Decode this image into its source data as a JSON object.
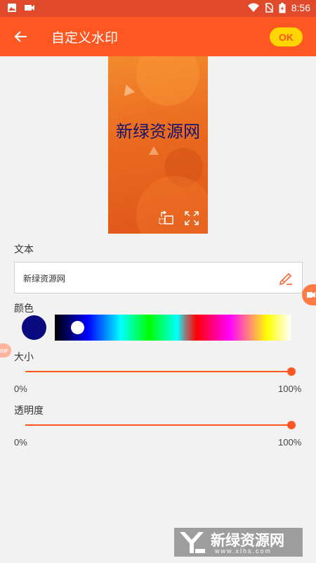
{
  "status_bar": {
    "time": "8:56"
  },
  "app_bar": {
    "title": "自定义水印",
    "ok_label": "OK"
  },
  "preview": {
    "watermark_text": "新绿资源网"
  },
  "text_section": {
    "label": "文本",
    "value": "新绿资源网"
  },
  "color_section": {
    "label": "颜色",
    "selected_color": "#0a0a80"
  },
  "size_section": {
    "label": "大小",
    "min_label": "0%",
    "max_label": "100%",
    "value": 1.0
  },
  "opacity_section": {
    "label": "透明度",
    "min_label": "0%",
    "max_label": "100%",
    "value": 1.0
  },
  "overlay_watermark": {
    "title": "新绿资源网",
    "url": "www.xlhs.com"
  },
  "side_tabs": {
    "left_label": "GIF"
  },
  "colors": {
    "accent": "#ff5722",
    "status_bar": "#e04a2a",
    "ok_button": "#ffd600"
  }
}
